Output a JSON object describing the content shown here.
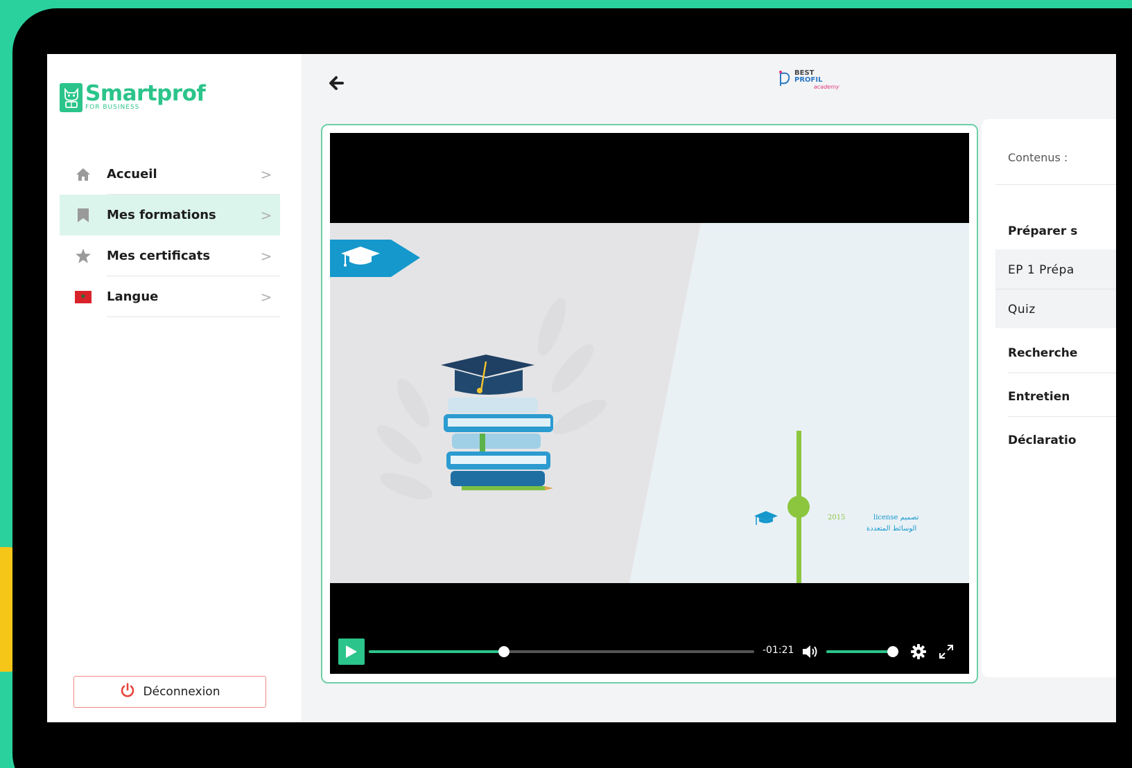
{
  "brand": {
    "name": "Smartprof",
    "tagline": "FOR BUSINESS",
    "accent_color": "#2bc48a"
  },
  "sidebar": {
    "items": [
      {
        "label": "Accueil",
        "icon": "home-icon",
        "active": false
      },
      {
        "label": "Mes formations",
        "icon": "bookmark-icon",
        "active": true
      },
      {
        "label": "Mes certificats",
        "icon": "star-icon",
        "active": false
      },
      {
        "label": "Langue",
        "icon": "morocco-flag-icon",
        "active": false
      }
    ],
    "logout_label": "Déconnexion"
  },
  "header": {
    "partner_logo": {
      "line1": "BEST",
      "line2": "PROFIL",
      "line3": "academy"
    }
  },
  "player": {
    "time_remaining": "-01:21",
    "progress": 0.35,
    "volume": 1.0,
    "slide": {
      "year": "2015",
      "caption_line1": "تصميم license",
      "caption_line2": "الوسائط المتعددة"
    }
  },
  "contents": {
    "title": "Contenus :",
    "items": [
      {
        "label": "Préparer s",
        "type": "section"
      },
      {
        "label": "EP 1 Prépa",
        "type": "lesson"
      },
      {
        "label": "Quiz",
        "type": "lesson"
      },
      {
        "label": "Recherche",
        "type": "section"
      },
      {
        "label": "Entretien",
        "type": "section"
      },
      {
        "label": "Déclaratio",
        "type": "section"
      }
    ]
  }
}
